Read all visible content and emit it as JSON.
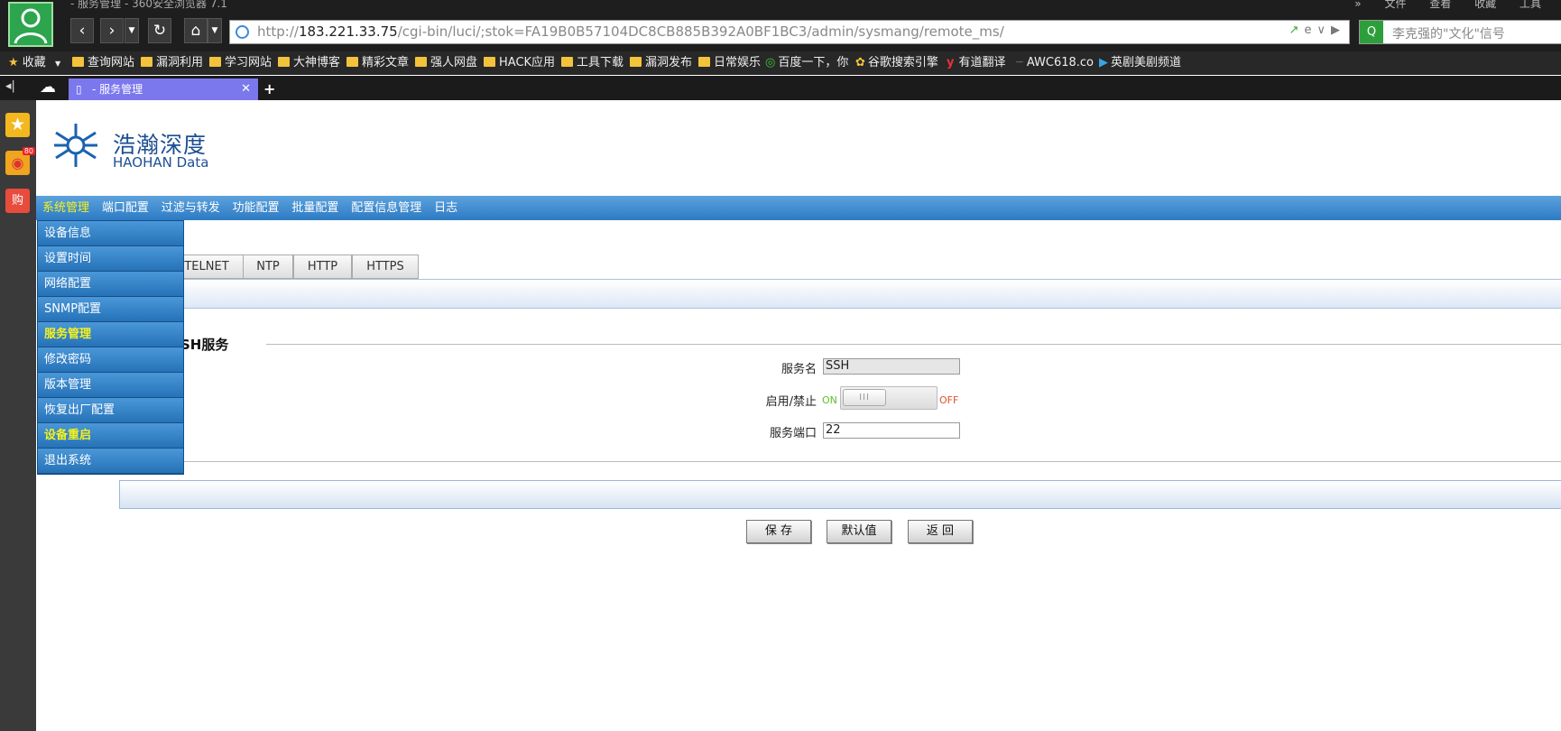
{
  "browser": {
    "title": "- 服务管理 - 360安全浏览器 7.1",
    "menu": [
      "»",
      "文件",
      "查看",
      "收藏",
      "工具"
    ],
    "url_host": "183.221.33.75",
    "url_prefix": "http://",
    "url_path": "/cgi-bin/luci/;stok=FA19B0B57104DC8CB885B392A0BF1BC3/admin/sysmang/remote_ms/",
    "search_placeholder": "李克强的\"文化\"信号",
    "tab_title": "- 服务管理",
    "bookmarks": [
      {
        "label": "收藏",
        "icon": "star-icon"
      },
      {
        "label": "查询网站",
        "icon": "folder-icon"
      },
      {
        "label": "漏洞利用",
        "icon": "folder-icon"
      },
      {
        "label": "学习网站",
        "icon": "folder-icon"
      },
      {
        "label": "大神博客",
        "icon": "folder-icon"
      },
      {
        "label": "精彩文章",
        "icon": "folder-icon"
      },
      {
        "label": "强人网盘",
        "icon": "folder-icon"
      },
      {
        "label": "HACK应用",
        "icon": "folder-icon"
      },
      {
        "label": "工具下载",
        "icon": "folder-icon"
      },
      {
        "label": "漏洞发布",
        "icon": "folder-icon"
      },
      {
        "label": "日常娱乐",
        "icon": "folder-icon"
      },
      {
        "label": "百度一下，你",
        "icon": "wifi-icon"
      },
      {
        "label": "谷歌搜索引擎",
        "icon": "paw-icon"
      },
      {
        "label": "有道翻译",
        "icon": "youdao-icon"
      },
      {
        "label": "AWC618.co",
        "icon": "dash-icon"
      },
      {
        "label": "英剧美剧频道",
        "icon": "play-icon"
      }
    ],
    "weibo_badge": "80",
    "shop_icon_label": "购"
  },
  "logo": {
    "cn": "浩瀚深度",
    "en": "HAOHAN Data"
  },
  "main_nav": [
    "系统管理",
    "端口配置",
    "过滤与转发",
    "功能配置",
    "批量配置",
    "配置信息管理",
    "日志"
  ],
  "dropdown": [
    "设备信息",
    "设置时间",
    "网络配置",
    "SNMP配置",
    "服务管理",
    "修改密码",
    "版本管理",
    "恢复出厂配置",
    "设备重启",
    "退出系统"
  ],
  "service_tabs": [
    "TELNET",
    "NTP",
    "HTTP",
    "HTTPS"
  ],
  "form": {
    "legend": "SH服务",
    "name_label": "服务名",
    "name_value": "SSH",
    "enable_label": "启用/禁止",
    "on": "ON",
    "off": "OFF",
    "toggle_grip": "III",
    "port_label": "服务端口",
    "port_value": "22"
  },
  "buttons": {
    "save": "保    存",
    "default": "默认值",
    "back": "返    回"
  }
}
